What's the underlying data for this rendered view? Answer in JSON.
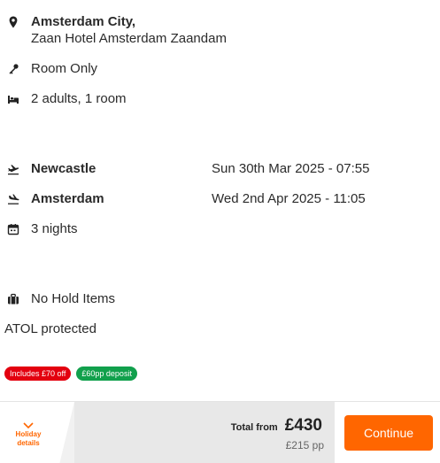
{
  "hotel": {
    "city": "Amsterdam City,",
    "name": "Zaan Hotel Amsterdam Zaandam",
    "board": "Room Only",
    "occupancy": "2 adults, 1 room"
  },
  "flights": [
    {
      "airport": "Newcastle",
      "datetime": "Sun 30th Mar 2025 - 07:55",
      "icon": "plane-departure-icon"
    },
    {
      "airport": "Amsterdam",
      "datetime": "Wed 2nd Apr 2025 - 11:05",
      "icon": "plane-arrival-icon"
    }
  ],
  "duration": "3 nights",
  "hold_items": "No Hold Items",
  "atol": "ATOL protected",
  "badges": {
    "offer": "Includes £70 off",
    "deposit": "£60pp deposit"
  },
  "footer": {
    "holiday_details_line1": "Holiday",
    "holiday_details_line2": "details",
    "total_label": "Total from",
    "total_amount": "£430",
    "per_person": "£215 pp",
    "continue_label": "Continue"
  },
  "colors": {
    "accent": "#ff6600",
    "offer_badge": "#e3000f",
    "deposit_badge": "#11a04c"
  }
}
